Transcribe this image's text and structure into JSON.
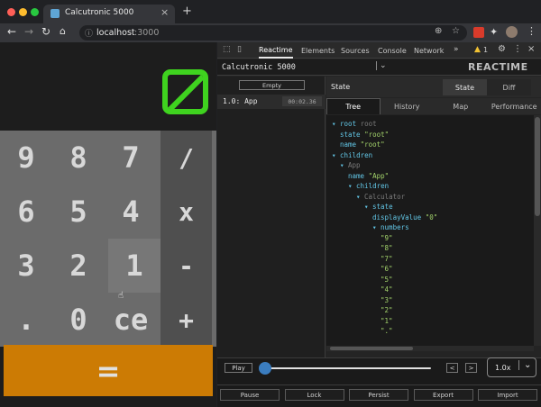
{
  "browser": {
    "tab_title": "Calcutronic 5000",
    "url_host": "localhost",
    "url_port": ":3000",
    "new_tab": "+",
    "tab_close": "×",
    "ext_badge": "1"
  },
  "calculator": {
    "display_symbol": "⊘",
    "keys": [
      "9",
      "8",
      "7",
      "/",
      "6",
      "5",
      "4",
      "x",
      "3",
      "2",
      "1",
      "-",
      ".",
      "0",
      "ce",
      "+"
    ],
    "equals": "="
  },
  "devtools": {
    "tabs": [
      "Reactime",
      "Elements",
      "Sources",
      "Console",
      "Network"
    ],
    "more": "»",
    "warning_count": "1",
    "app_select": "Calcutronic 5000",
    "logo": "REACTIME",
    "empty_button": "Empty",
    "snapshot": {
      "label": "1.0: App",
      "time": "00:02.36"
    },
    "state_title": "State",
    "state_toggle": [
      "State",
      "Diff"
    ],
    "view_tabs": [
      "Tree",
      "History",
      "Map",
      "Performance"
    ],
    "tree": [
      {
        "indent": 0,
        "arrow": "▾",
        "key": "root",
        "val": "root",
        "vtype": "g"
      },
      {
        "indent": 1,
        "arrow": "",
        "key": "state",
        "val": "\"root\"",
        "vtype": "sv"
      },
      {
        "indent": 1,
        "arrow": "",
        "key": "name",
        "val": "\"root\"",
        "vtype": "sv"
      },
      {
        "indent": 0,
        "arrow": "▾",
        "key": "children",
        "val": "",
        "vtype": "sv"
      },
      {
        "indent": 1,
        "arrow": "▾",
        "key": "App",
        "val": "",
        "vtype": "g",
        "dim": true
      },
      {
        "indent": 2,
        "arrow": "",
        "key": "name",
        "val": "\"App\"",
        "vtype": "sv"
      },
      {
        "indent": 2,
        "arrow": "▾",
        "key": "children",
        "val": "",
        "vtype": "sv"
      },
      {
        "indent": 3,
        "arrow": "▾",
        "key": "Calculator",
        "val": "",
        "vtype": "g",
        "dim": true
      },
      {
        "indent": 4,
        "arrow": "▾",
        "key": "state",
        "val": "",
        "vtype": "sv"
      },
      {
        "indent": 5,
        "arrow": "",
        "key": "displayValue",
        "val": "\"0\"",
        "vtype": "sv"
      },
      {
        "indent": 5,
        "arrow": "▾",
        "key": "numbers",
        "val": "",
        "vtype": "sv"
      },
      {
        "indent": 6,
        "arrow": "",
        "key": "",
        "val": "\"9\"",
        "vtype": "sv"
      },
      {
        "indent": 6,
        "arrow": "",
        "key": "",
        "val": "\"8\"",
        "vtype": "sv"
      },
      {
        "indent": 6,
        "arrow": "",
        "key": "",
        "val": "\"7\"",
        "vtype": "sv"
      },
      {
        "indent": 6,
        "arrow": "",
        "key": "",
        "val": "\"6\"",
        "vtype": "sv"
      },
      {
        "indent": 6,
        "arrow": "",
        "key": "",
        "val": "\"5\"",
        "vtype": "sv"
      },
      {
        "indent": 6,
        "arrow": "",
        "key": "",
        "val": "\"4\"",
        "vtype": "sv"
      },
      {
        "indent": 6,
        "arrow": "",
        "key": "",
        "val": "\"3\"",
        "vtype": "sv"
      },
      {
        "indent": 6,
        "arrow": "",
        "key": "",
        "val": "\"2\"",
        "vtype": "sv"
      },
      {
        "indent": 6,
        "arrow": "",
        "key": "",
        "val": "\"1\"",
        "vtype": "sv"
      },
      {
        "indent": 6,
        "arrow": "",
        "key": "",
        "val": "\".\"",
        "vtype": "sv"
      }
    ],
    "play": "Play",
    "slider_position": 0,
    "prev": "<",
    "next": ">",
    "speed": "1.0x",
    "bottom_buttons": [
      "Pause",
      "Lock",
      "Persist",
      "Export",
      "Import"
    ],
    "colors": {
      "accent": "#62c6e6",
      "string": "#a3d36b",
      "equals": "#cc7b04",
      "display": "#3fd31f"
    }
  }
}
